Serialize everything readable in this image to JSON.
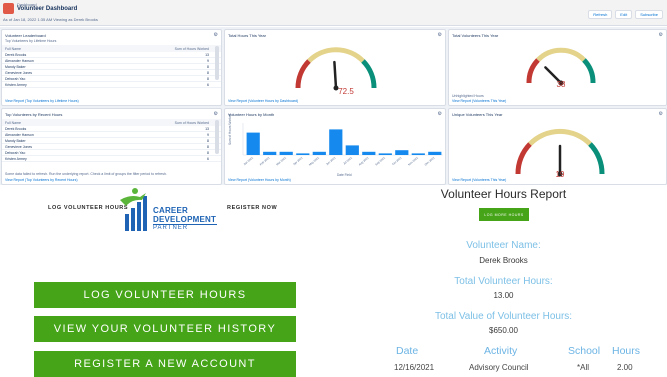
{
  "dashboard": {
    "kicker": "Dashboard",
    "title": "Volunteer Dashboard",
    "subtitle": "As of Jan 18, 2022 1:35 AM Viewing as Derek Brooks",
    "buttons": [
      "Refresh",
      "Edit",
      "Subscribe"
    ],
    "panels": {
      "leaderboard": {
        "title": "Volunteer Leaderboard",
        "subtitle": "Top Volunteers by Lifetime Hours",
        "col1": "Full Name",
        "col2": "Sum of Hours Worked",
        "rows": [
          {
            "name": "Derek Brooks",
            "value": "13"
          },
          {
            "name": "Alexander Hanson",
            "value": "9"
          },
          {
            "name": "Mandy Baker",
            "value": "8"
          },
          {
            "name": "Genevieve Jones",
            "value": "8"
          },
          {
            "name": "Deborah Yao",
            "value": "8"
          },
          {
            "name": "Kristen Armey",
            "value": "6"
          }
        ],
        "link": "View Report (Top Volunteers by Lifetime Hours)"
      },
      "recent": {
        "title": "Top Volunteers by Recent Hours",
        "col1": "Full Name",
        "col2": "Sum of Hours Worked",
        "rows": [
          {
            "name": "Derek Brooks",
            "value": "13"
          },
          {
            "name": "Alexander Hanson",
            "value": "9"
          },
          {
            "name": "Mandy Baker",
            "value": "8"
          },
          {
            "name": "Genevieve Jones",
            "value": "8"
          },
          {
            "name": "Deborah Yao",
            "value": "8"
          },
          {
            "name": "Kristen Armey",
            "value": "6"
          }
        ],
        "note": "Some data failed to refresh. Run the underlying report. Check a limit of groups the filter period to refresh.",
        "link": "View Report (Top Volunteers by Recent Hours)"
      },
      "gauge1": {
        "title": "Total Hours This Year",
        "value": "72.5",
        "fill": 0.48,
        "link": "View Report (Volunteer Hours by Dashboard)"
      },
      "gauge2": {
        "title": "Total Volunteers This Year",
        "value": "38",
        "fill": 0.25,
        "note": "Unhighlighted Hours",
        "link": "View Report (Volunteers This Year)"
      },
      "gauge3": {
        "title": "Unique Volunteers This Year",
        "value": "19",
        "fill": 0.5,
        "link": "View Report (Volunteers This Year)"
      },
      "bar": {
        "title": "Volunteer Hours by Month",
        "xlabel": "Date Field",
        "ylabel": "Sum of Hours Worked",
        "link": "View Report (Volunteer Hours by Month)"
      }
    }
  },
  "chart_data": {
    "type": "bar",
    "categories": [
      "Jan 2021",
      "Feb 2021",
      "Mar 2021",
      "Apr 2021",
      "May 2021",
      "Jun 2021",
      "Jul 2021",
      "Aug 2021",
      "Sep 2021",
      "Oct 2021",
      "Nov 2021",
      "Dec 2021"
    ],
    "values": [
      7,
      1,
      1,
      0.5,
      1,
      8,
      3,
      1,
      0.5,
      1.5,
      0.5,
      1
    ],
    "ylim": [
      0,
      10
    ]
  },
  "nav": {
    "log_label": "LOG VOLUNTEER HOURS",
    "register_label": "REGISTER NOW",
    "logo_line1": "CAREER",
    "logo_line2": "DEVELOPMENT",
    "logo_line3": "PARTNER"
  },
  "actions": {
    "log": "LOG VOLUNTEER HOURS",
    "history": "VIEW YOUR VOLUNTEER HISTORY",
    "register": "REGISTER A NEW ACCOUNT"
  },
  "report": {
    "title": "Volunteer Hours Report",
    "log_button": "LOG MORE HOURS",
    "name_label": "Volunteer Name:",
    "name_value": "Derek Brooks",
    "total_label": "Total Volunteer Hours:",
    "total_value": "13.00",
    "value_label": "Total Value of Volunteer Hours:",
    "value_value": "$650.00",
    "columns": [
      "Date",
      "Activity",
      "School",
      "Hours"
    ],
    "row": [
      "12/16/2021",
      "Advisory Council",
      "*All",
      "2.00"
    ]
  },
  "colors": {
    "green": "#45a418",
    "light_blue": "#7dc0e6",
    "gauge_red": "#c23934",
    "gauge_yellow": "#e4d38a",
    "gauge_teal": "#0a8f7a"
  }
}
